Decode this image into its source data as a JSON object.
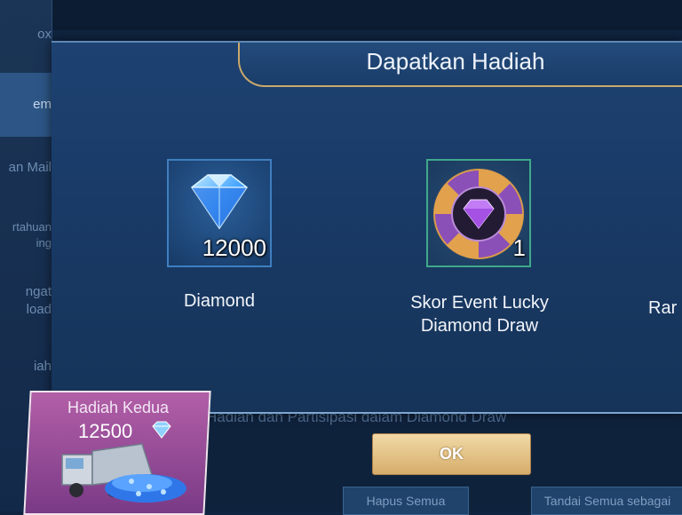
{
  "background": {
    "sidebar": {
      "items": [
        {
          "label": "ox"
        },
        {
          "label": "em"
        },
        {
          "label": "an Mail"
        },
        {
          "label": "rtahuan"
        },
        {
          "label": "ing"
        },
        {
          "label": "ngat"
        },
        {
          "label": "load"
        },
        {
          "label": "iah"
        }
      ]
    },
    "bottom_text": "Hadiah dan Partisipasi dalam Diamond Draw",
    "buttons": {
      "delete_all": "Hapus Semua",
      "mark_all": "Tandai Semua sebagai"
    }
  },
  "dialog": {
    "title": "Dapatkan Hadiah",
    "rewards": [
      {
        "label": "Diamond",
        "count": "12000",
        "icon": "diamond-icon"
      },
      {
        "label_line1": "Skor Event Lucky",
        "label_line2": "Diamond Draw",
        "count": "1",
        "icon": "lucky-diamond-chip-icon"
      },
      {
        "label": "Rar"
      }
    ],
    "ok_label": "OK"
  },
  "second_reward": {
    "title": "Hadiah Kedua",
    "amount": "12500",
    "icon": "diamond-truck-icon"
  },
  "colors": {
    "dialog_bg": "#1d4272",
    "gold_accent": "#c9a96b",
    "ok_button": "#e6c48a",
    "second_card": "#9a4e99"
  }
}
